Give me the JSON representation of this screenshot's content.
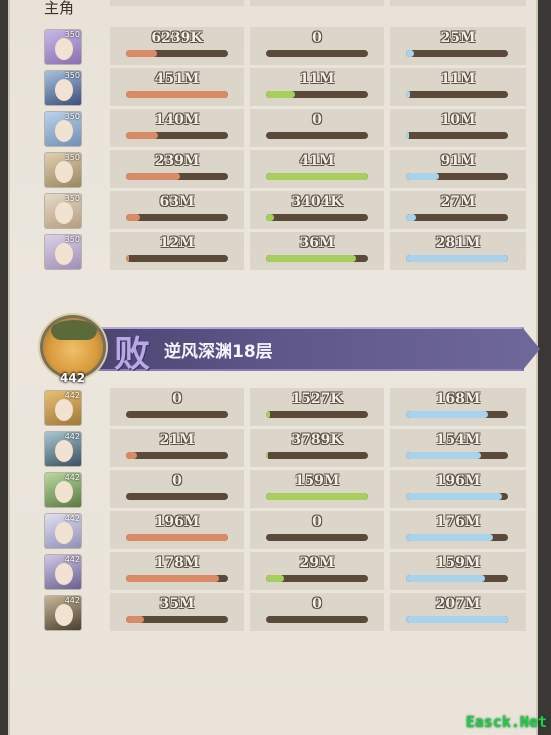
{
  "top_section": {
    "header_label": "主角",
    "rows": [
      {
        "level": "350",
        "dmg": "6239K",
        "dmg_pct": 0.3,
        "tank": "0",
        "tank_pct": 0,
        "heal": "25M",
        "heal_pct": 0.08,
        "colors": [
          "#c8b8e8",
          "#8a6fb0"
        ]
      },
      {
        "level": "350",
        "dmg": "451M",
        "dmg_pct": 1.0,
        "tank": "11M",
        "tank_pct": 0.28,
        "heal": "11M",
        "heal_pct": 0.04,
        "colors": [
          "#a9c0e0",
          "#3c4f78"
        ]
      },
      {
        "level": "350",
        "dmg": "140M",
        "dmg_pct": 0.31,
        "tank": "0",
        "tank_pct": 0,
        "heal": "10M",
        "heal_pct": 0.03,
        "colors": [
          "#bcd3ea",
          "#6f8fb5"
        ]
      },
      {
        "level": "350",
        "dmg": "239M",
        "dmg_pct": 0.53,
        "tank": "41M",
        "tank_pct": 1.0,
        "heal": "91M",
        "heal_pct": 0.32,
        "colors": [
          "#dfd0b0",
          "#9a8660"
        ]
      },
      {
        "level": "350",
        "dmg": "63M",
        "dmg_pct": 0.14,
        "tank": "3404K",
        "tank_pct": 0.08,
        "heal": "27M",
        "heal_pct": 0.1,
        "colors": [
          "#e5dac6",
          "#b59c80"
        ]
      },
      {
        "level": "350",
        "dmg": "12M",
        "dmg_pct": 0.03,
        "tank": "36M",
        "tank_pct": 0.88,
        "heal": "281M",
        "heal_pct": 1.0,
        "colors": [
          "#dcd0e6",
          "#a08fb8"
        ]
      }
    ]
  },
  "banner": {
    "result_text": "败",
    "stage_text": "逆风深渊18层",
    "player_level": "442"
  },
  "bottom_section": {
    "rows": [
      {
        "level": "442",
        "dmg": "0",
        "dmg_pct": 0,
        "tank": "1527K",
        "tank_pct": 0.04,
        "heal": "168M",
        "heal_pct": 0.8,
        "colors": [
          "#e8c070",
          "#a07838"
        ]
      },
      {
        "level": "442",
        "dmg": "21M",
        "dmg_pct": 0.11,
        "tank": "3789K",
        "tank_pct": 0.02,
        "heal": "154M",
        "heal_pct": 0.74,
        "colors": [
          "#a8c8d0",
          "#3a5060"
        ]
      },
      {
        "level": "442",
        "dmg": "0",
        "dmg_pct": 0,
        "tank": "159M",
        "tank_pct": 1.0,
        "heal": "196M",
        "heal_pct": 0.94,
        "colors": [
          "#b8d8a0",
          "#5a7a40"
        ]
      },
      {
        "level": "442",
        "dmg": "196M",
        "dmg_pct": 1.0,
        "tank": "0",
        "tank_pct": 0,
        "heal": "176M",
        "heal_pct": 0.85,
        "colors": [
          "#e0e0f0",
          "#9090b8"
        ]
      },
      {
        "level": "442",
        "dmg": "178M",
        "dmg_pct": 0.91,
        "tank": "29M",
        "tank_pct": 0.18,
        "heal": "159M",
        "heal_pct": 0.77,
        "colors": [
          "#d0c8e8",
          "#6a6090"
        ]
      },
      {
        "level": "442",
        "dmg": "35M",
        "dmg_pct": 0.18,
        "tank": "0",
        "tank_pct": 0,
        "heal": "207M",
        "heal_pct": 1.0,
        "colors": [
          "#c8b898",
          "#4a4030"
        ]
      }
    ]
  },
  "watermark": "Easck.Net",
  "colors": {
    "damage": "#d98a67",
    "tank": "#a7cf5e",
    "heal": "#a9d2ec",
    "bar_track": "#5b4a3a",
    "banner": "#5e5688"
  }
}
